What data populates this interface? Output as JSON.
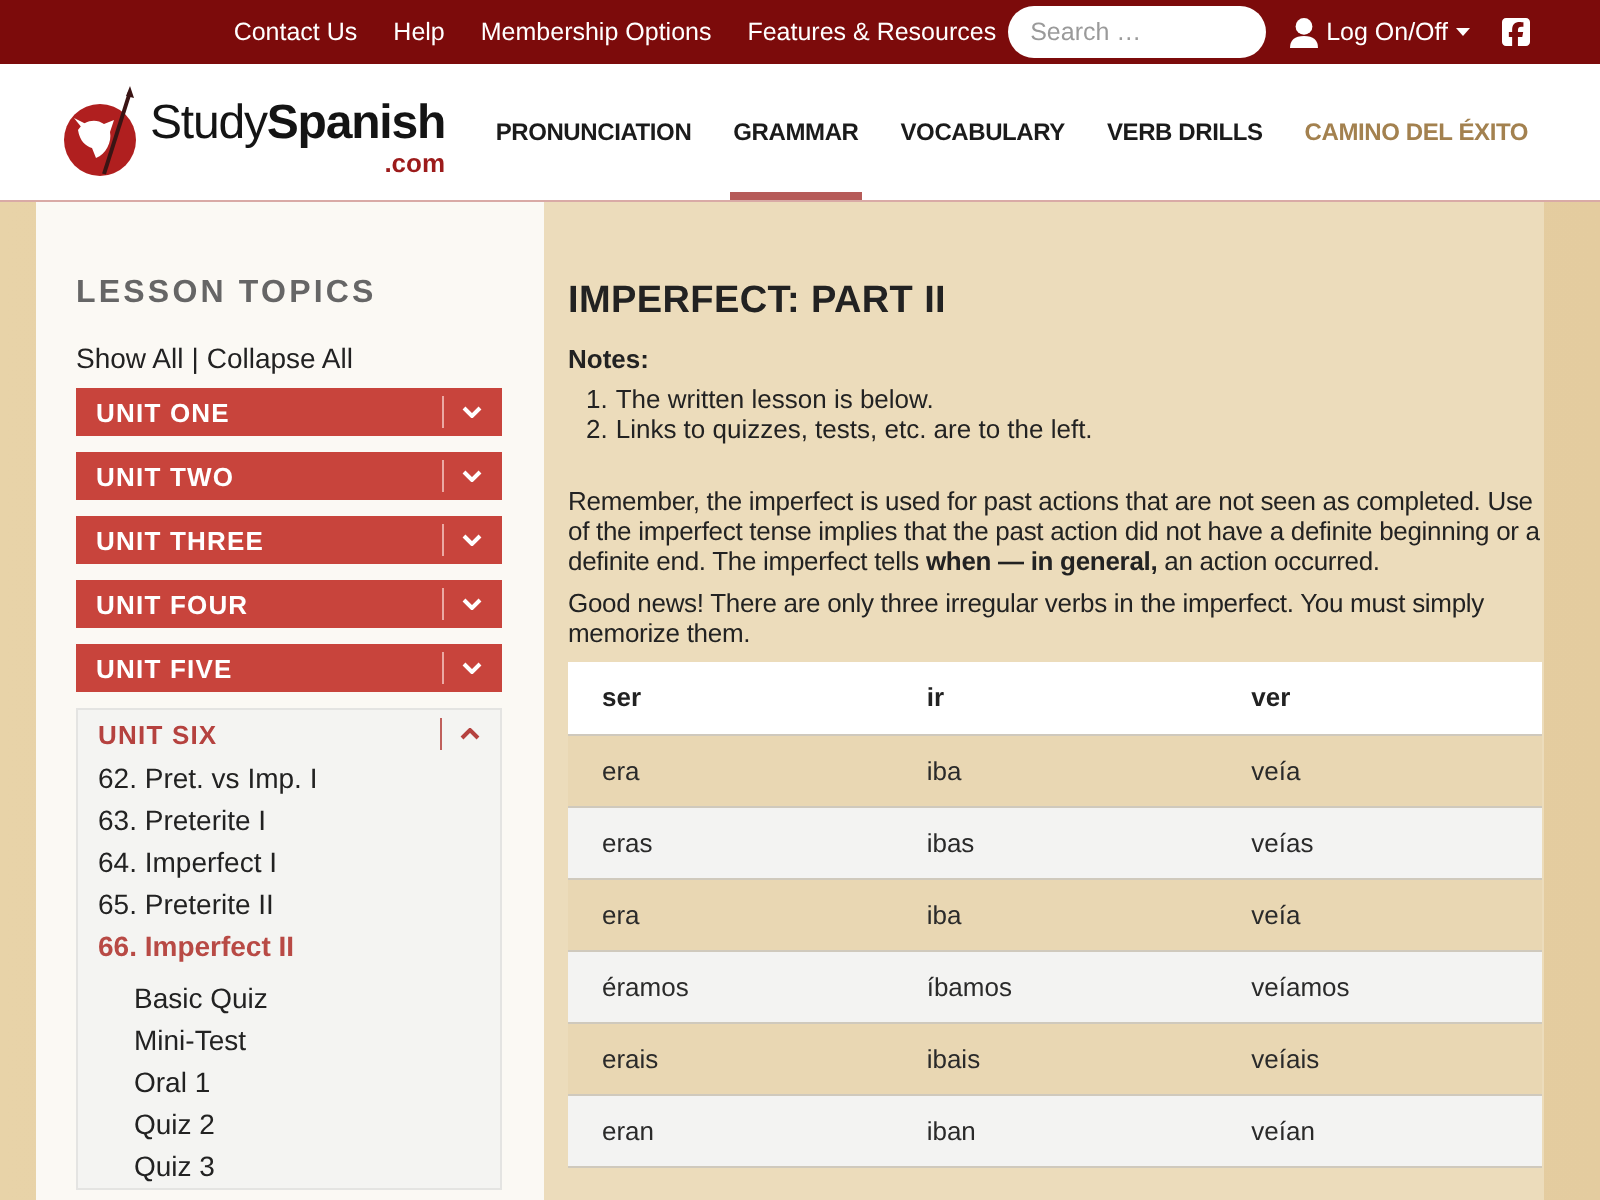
{
  "top_bar": {
    "links": [
      "Contact Us",
      "Help",
      "Membership Options",
      "Features & Resources"
    ],
    "search": {
      "placeholder": "Search …"
    },
    "account": {
      "label": "Log On/Off"
    }
  },
  "header": {
    "logo": {
      "wordmark": "Study**Spanish**",
      "domain": ".com"
    },
    "nav": [
      {
        "label": "PRONUNCIATION",
        "kind": "regular",
        "selected": false
      },
      {
        "label": "GRAMMAR",
        "kind": "regular",
        "selected": true
      },
      {
        "label": "VOCABULARY",
        "kind": "regular",
        "selected": false
      },
      {
        "label": "VERB DRILLS",
        "kind": "regular",
        "selected": false
      },
      {
        "label": "CAMINO DEL ÉXITO",
        "kind": "featured",
        "selected": false
      }
    ]
  },
  "sidebar": {
    "title": "LESSON TOPICS",
    "show_all": "Show All",
    "separator": "|",
    "collapse_all": "Collapse All",
    "units": [
      {
        "label": "UNIT ONE",
        "expanded": false
      },
      {
        "label": "UNIT TWO",
        "expanded": false
      },
      {
        "label": "UNIT THREE",
        "expanded": false
      },
      {
        "label": "UNIT FOUR",
        "expanded": false
      },
      {
        "label": "UNIT FIVE",
        "expanded": false
      },
      {
        "label": "UNIT SIX",
        "expanded": true,
        "lessons": [
          {
            "label": "62. Pret. vs Imp. I",
            "selected": false
          },
          {
            "label": "63. Preterite I",
            "selected": false
          },
          {
            "label": "64. Imperfect I",
            "selected": false
          },
          {
            "label": "65. Preterite II",
            "selected": false
          },
          {
            "label": "66. Imperfect II",
            "selected": true,
            "children": [
              {
                "label": "Basic Quiz"
              },
              {
                "label": "Mini-Test"
              },
              {
                "label": "Oral 1"
              },
              {
                "label": "Quiz 2"
              },
              {
                "label": "Quiz 3"
              }
            ]
          }
        ]
      }
    ]
  },
  "lesson": {
    "title": "IMPERFECT: PART II",
    "notes_label": "Notes:",
    "notes": [
      {
        "number": "1.",
        "text": "The written lesson is below."
      },
      {
        "number": "2.",
        "text": "Links to quizzes, tests, etc. are to the left."
      }
    ],
    "paragraphs": [
      "Remember, the imperfect is used for past actions that are not seen as completed. Use of the imperfect tense implies that the past action did not have a definite beginning or a definite end. The imperfect tells **when — in general,** an action occurred.",
      "Good news! There are only three irregular verbs in the imperfect. You must simply memorize them."
    ],
    "table": {
      "columns": [
        "ser",
        "ir",
        "ver"
      ],
      "rows": [
        [
          "era",
          "iba",
          "veía"
        ],
        [
          "eras",
          "ibas",
          "veías"
        ],
        [
          "era",
          "iba",
          "veía"
        ],
        [
          "éramos",
          "íbamos",
          "veíamos"
        ],
        [
          "erais",
          "ibais",
          "veíais"
        ],
        [
          "eran",
          "iban",
          "veían"
        ]
      ]
    }
  }
}
